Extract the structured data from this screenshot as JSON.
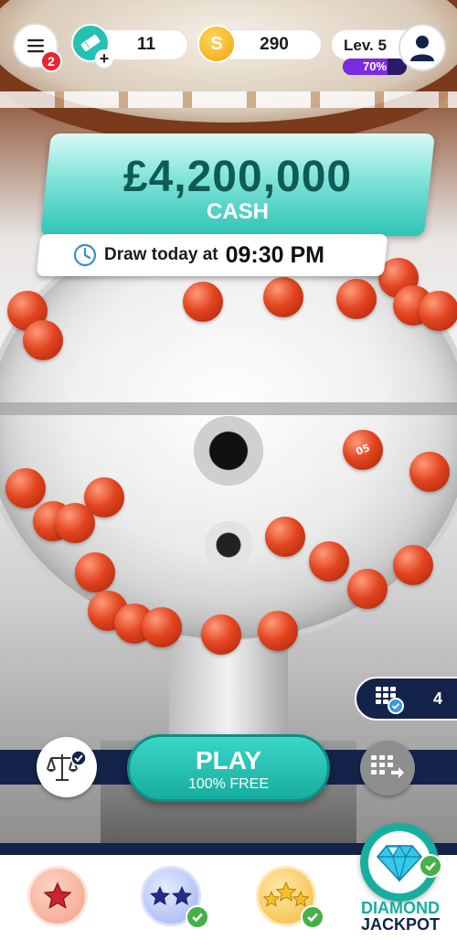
{
  "header": {
    "notifications_badge": "2",
    "tickets": "11",
    "coins": "290",
    "coin_symbol": "S",
    "ticket_add": "+",
    "level_label": "Lev. 5",
    "level_progress_text": "70%",
    "level_progress": 0.7
  },
  "jackpot": {
    "amount": "£4,200,000",
    "type": "CASH",
    "draw_label": "Draw today at",
    "draw_time": "09:30 PM"
  },
  "balls": [
    "05",
    "",
    "",
    "",
    "",
    "",
    "",
    "",
    "",
    "",
    "",
    "",
    "",
    "",
    "",
    "",
    "",
    "",
    "",
    "",
    "",
    "",
    "",
    ""
  ],
  "ticket_counter": {
    "value": "4"
  },
  "play": {
    "label": "PLAY",
    "sublabel": "100% FREE"
  },
  "bottom_nav": {
    "diamond_line1": "DIAMOND",
    "diamond_line2": "JACKPOT"
  },
  "colors": {
    "accent": "#17ad9f",
    "navy": "#13234a",
    "badge": "#e6262e",
    "level_purple": "#7b2be0",
    "ball_red": "#e2451f"
  },
  "icons": [
    "hamburger-menu-icon",
    "ticket-icon",
    "coin-icon",
    "user-avatar-icon",
    "clock-icon",
    "ticket-grid-icon",
    "scales-icon",
    "quick-pick-icon",
    "star-icon",
    "diamond-icon",
    "checkmark-icon"
  ]
}
